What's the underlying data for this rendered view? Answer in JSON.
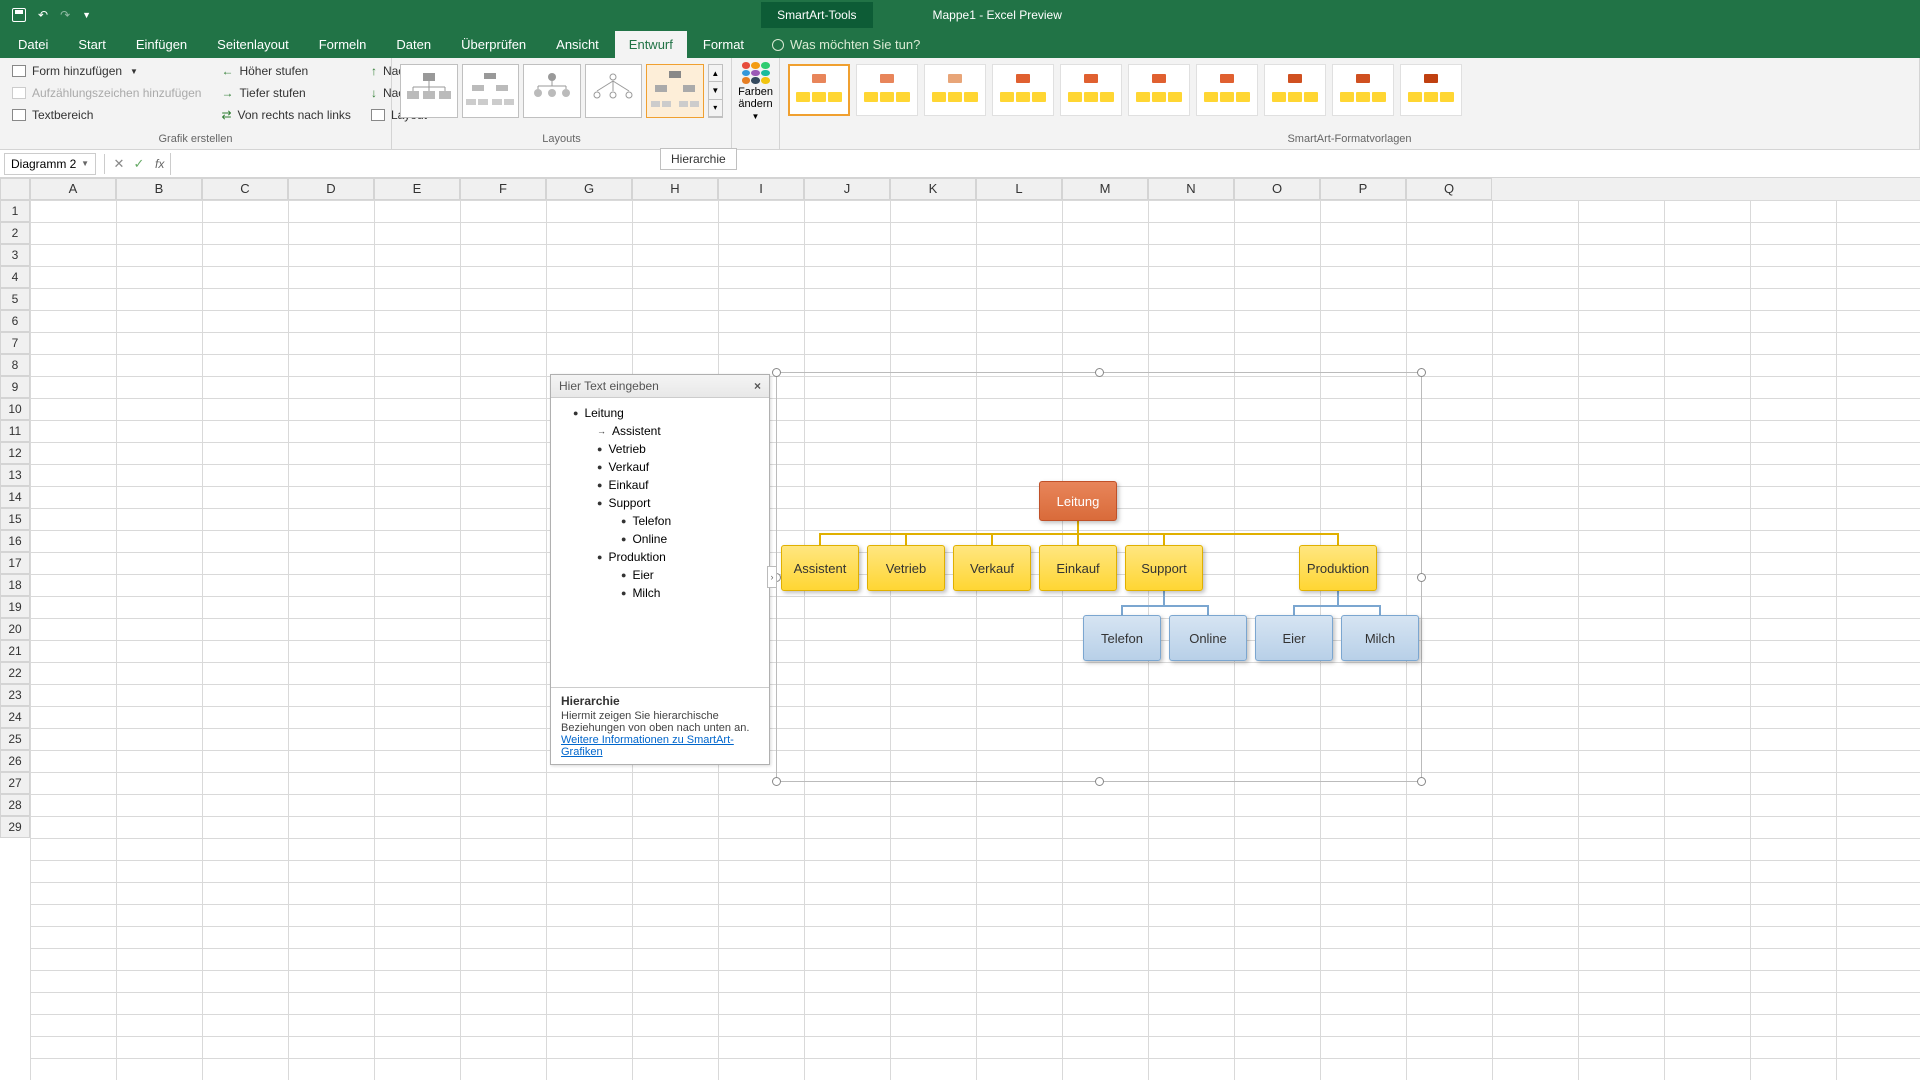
{
  "titlebar": {
    "contextual_tab": "SmartArt-Tools",
    "doc_title": "Mappe1  -  Excel Preview"
  },
  "ribbon_tabs": [
    "Datei",
    "Start",
    "Einfügen",
    "Seitenlayout",
    "Formeln",
    "Daten",
    "Überprüfen",
    "Ansicht",
    "Entwurf",
    "Format"
  ],
  "active_tab": "Entwurf",
  "tellme_placeholder": "Was möchten Sie tun?",
  "grafik": {
    "form_hinzu": "Form hinzufügen",
    "aufzaehl": "Aufzählungszeichen hinzufügen",
    "textbereich": "Textbereich",
    "hoeher": "Höher stufen",
    "tiefer": "Tiefer stufen",
    "rechts_links": "Von rechts nach links",
    "nach_oben": "Nach oben",
    "nach_unten": "Nach unten",
    "layout": "Layout",
    "group_label": "Grafik erstellen"
  },
  "layouts_label": "Layouts",
  "layout_tooltip": "Hierarchie",
  "colors_label": "Farben ändern",
  "styles_label": "SmartArt-Formatvorlagen",
  "name_box": "Diagramm 2",
  "fx_label": "fx",
  "columns": [
    "A",
    "B",
    "C",
    "D",
    "E",
    "F",
    "G",
    "H",
    "I",
    "J",
    "K",
    "L",
    "M",
    "N",
    "O",
    "P",
    "Q"
  ],
  "row_count": 29,
  "text_pane": {
    "title": "Hier Text eingeben",
    "items": [
      {
        "level": 0,
        "bullet": "●",
        "text": "Leitung"
      },
      {
        "level": 1,
        "bullet": "→",
        "text": "Assistent"
      },
      {
        "level": 1,
        "bullet": "●",
        "text": "Vetrieb"
      },
      {
        "level": 1,
        "bullet": "●",
        "text": "Verkauf"
      },
      {
        "level": 1,
        "bullet": "●",
        "text": "Einkauf"
      },
      {
        "level": 1,
        "bullet": "●",
        "text": "Support"
      },
      {
        "level": 2,
        "bullet": "●",
        "text": "Telefon"
      },
      {
        "level": 2,
        "bullet": "●",
        "text": "Online"
      },
      {
        "level": 1,
        "bullet": "●",
        "text": "Produktion"
      },
      {
        "level": 2,
        "bullet": "●",
        "text": "Eier"
      },
      {
        "level": 2,
        "bullet": "●",
        "text": "Milch"
      }
    ],
    "footer_title": "Hierarchie",
    "footer_text": "Hiermit zeigen Sie hierarchische Beziehungen von oben nach unten an.",
    "footer_link": "Weitere Informationen zu SmartArt-Grafiken"
  },
  "chart_data": {
    "type": "hierarchy",
    "root": {
      "label": "Leitung",
      "children": [
        {
          "label": "Assistent"
        },
        {
          "label": "Vetrieb"
        },
        {
          "label": "Verkauf"
        },
        {
          "label": "Einkauf"
        },
        {
          "label": "Support",
          "children": [
            {
              "label": "Telefon"
            },
            {
              "label": "Online"
            }
          ]
        },
        {
          "label": "Produktion",
          "children": [
            {
              "label": "Eier"
            },
            {
              "label": "Milch"
            }
          ]
        }
      ]
    }
  },
  "nodes": {
    "root": "Leitung",
    "l2": [
      "Assistent",
      "Vetrieb",
      "Verkauf",
      "Einkauf",
      "Support",
      "Produktion"
    ],
    "l3": [
      "Telefon",
      "Online",
      "Eier",
      "Milch"
    ]
  }
}
